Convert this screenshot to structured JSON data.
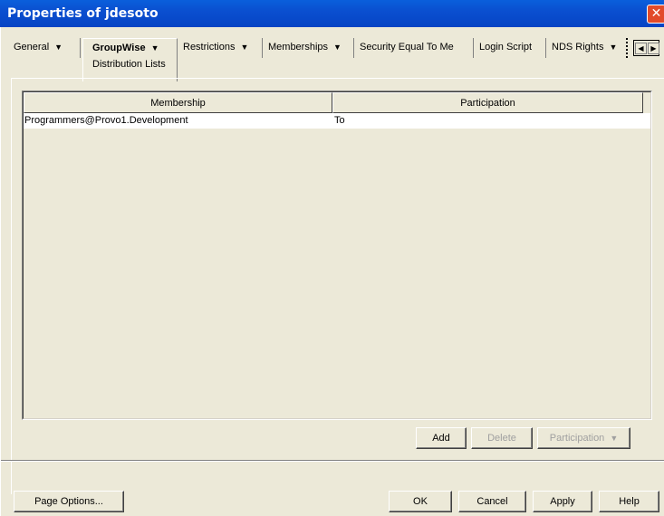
{
  "window": {
    "title": "Properties of jdesoto",
    "close_glyph": "✕"
  },
  "tabs": [
    {
      "label": "General"
    },
    {
      "label": "GroupWise",
      "sublabel": "Distribution Lists"
    },
    {
      "label": "Restrictions"
    },
    {
      "label": "Memberships"
    },
    {
      "label": "Security Equal To Me"
    },
    {
      "label": "Login Script"
    },
    {
      "label": "NDS Rights"
    }
  ],
  "tab_dropdown_glyph": "▼",
  "scroll": {
    "left_glyph": "◀",
    "right_glyph": "▶"
  },
  "table": {
    "columns": [
      "Membership",
      "Participation"
    ],
    "rows": [
      {
        "membership": "Programmers@Provo1.Development",
        "participation": "To"
      }
    ]
  },
  "actions": {
    "add": "Add",
    "delete": "Delete",
    "participation": "Participation",
    "participation_glyph": "▼"
  },
  "footer": {
    "page_options": "Page Options...",
    "ok": "OK",
    "cancel": "Cancel",
    "apply": "Apply",
    "help": "Help"
  },
  "colors": {
    "titlebar": "#0a4fd0",
    "close": "#e24b2a",
    "dialog": "#ece9d8"
  }
}
